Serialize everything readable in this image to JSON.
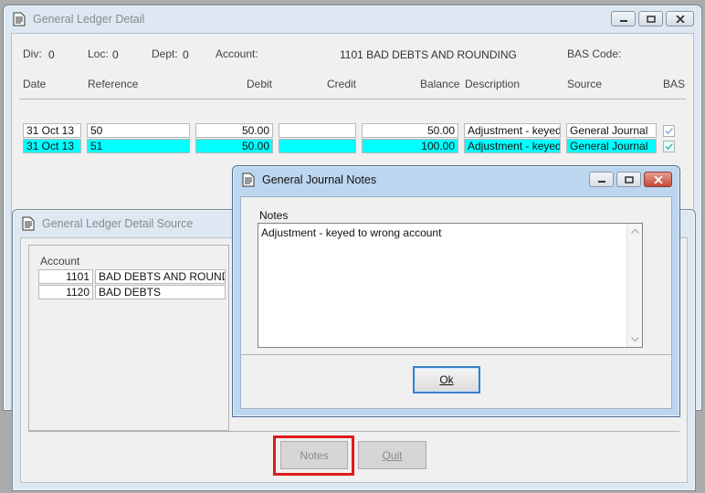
{
  "ledger_window": {
    "title": "General Ledger Detail",
    "header": {
      "div_label": "Div:",
      "div_value": "0",
      "loc_label": "Loc:",
      "loc_value": "0",
      "dept_label": "Dept:",
      "dept_value": "0",
      "account_label": "Account:",
      "account_value": "1101  BAD DEBTS AND ROUNDING",
      "bas_code_label": "BAS Code:"
    },
    "columns": [
      "Date",
      "Reference",
      "Debit",
      "Credit",
      "Balance",
      "Description",
      "Source",
      "BAS"
    ],
    "rows": [
      {
        "date": "31 Oct 13",
        "reference": "50",
        "debit": "50.00",
        "credit": "",
        "balance": "50.00",
        "description": "Adjustment - keyed t",
        "source": "General Journal",
        "bas_checked": true,
        "selected": false
      },
      {
        "date": "31 Oct 13",
        "reference": "51",
        "debit": "50.00",
        "credit": "",
        "balance": "100.00",
        "description": "Adjustment - keyed t",
        "source": "General Journal",
        "bas_checked": true,
        "selected": true
      }
    ]
  },
  "source_window": {
    "title": "General Ledger Detail Source",
    "account_header": "Account",
    "accounts": [
      {
        "code": "1101",
        "name": "BAD DEBTS AND ROUNDING"
      },
      {
        "code": "1120",
        "name": "BAD DEBTS"
      }
    ],
    "notes_button": "Notes",
    "quit_button": "Quit"
  },
  "notes_dialog": {
    "title": "General Journal Notes",
    "notes_label": "Notes",
    "notes_text": "Adjustment - keyed to wrong account",
    "ok_button": "Ok"
  },
  "colors": {
    "selected_row": "#00ffff",
    "highlight_box": "#e01b1b",
    "focus_border": "#3b80c6"
  }
}
